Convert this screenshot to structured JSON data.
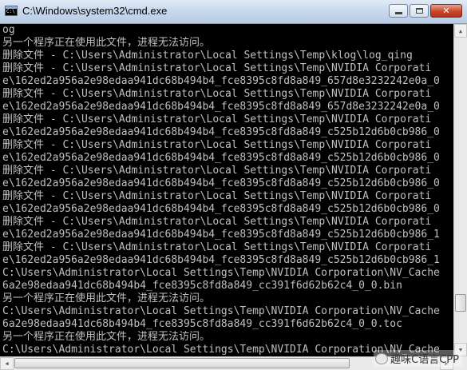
{
  "window": {
    "title": "C:\\Windows\\system32\\cmd.exe",
    "controls": {
      "minimize": "minimize",
      "maximize": "maximize",
      "close": "✕"
    }
  },
  "console": {
    "lines": [
      "og",
      "另一个程序正在使用此文件，进程无法访问。",
      "删除文件 - C:\\Users\\Administrator\\Local Settings\\Temp\\klog\\log_qing",
      "删除文件 - C:\\Users\\Administrator\\Local Settings\\Temp\\NVIDIA Corporati",
      "e\\162ed2a956a2e98edaa941dc68b494b4_fce8395c8fd8a849_657d8e3232242e0a_0",
      "删除文件 - C:\\Users\\Administrator\\Local Settings\\Temp\\NVIDIA Corporati",
      "e\\162ed2a956a2e98edaa941dc68b494b4_fce8395c8fd8a849_657d8e3232242e0a_0",
      "删除文件 - C:\\Users\\Administrator\\Local Settings\\Temp\\NVIDIA Corporati",
      "e\\162ed2a956a2e98edaa941dc68b494b4_fce8395c8fd8a849_c525b12d6b0cb986_0",
      "删除文件 - C:\\Users\\Administrator\\Local Settings\\Temp\\NVIDIA Corporati",
      "e\\162ed2a956a2e98edaa941dc68b494b4_fce8395c8fd8a849_c525b12d6b0cb986_0",
      "删除文件 - C:\\Users\\Administrator\\Local Settings\\Temp\\NVIDIA Corporati",
      "e\\162ed2a956a2e98edaa941dc68b494b4_fce8395c8fd8a849_c525b12d6b0cb986_0",
      "删除文件 - C:\\Users\\Administrator\\Local Settings\\Temp\\NVIDIA Corporati",
      "e\\162ed2a956a2e98edaa941dc68b494b4_fce8395c8fd8a849_c525b12d6b0cb986_0",
      "删除文件 - C:\\Users\\Administrator\\Local Settings\\Temp\\NVIDIA Corporati",
      "e\\162ed2a956a2e98edaa941dc68b494b4_fce8395c8fd8a849_c525b12d6b0cb986_1",
      "删除文件 - C:\\Users\\Administrator\\Local Settings\\Temp\\NVIDIA Corporati",
      "e\\162ed2a956a2e98edaa941dc68b494b4_fce8395c8fd8a849_c525b12d6b0cb986_1",
      "C:\\Users\\Administrator\\Local Settings\\Temp\\NVIDIA Corporation\\NV_Cache",
      "6a2e98edaa941dc68b494b4_fce8395c8fd8a849_cc391f6d62b62c4_0_0.bin",
      "另一个程序正在使用此文件，进程无法访问。",
      "C:\\Users\\Administrator\\Local Settings\\Temp\\NVIDIA Corporation\\NV_Cache",
      "6a2e98edaa941dc68b494b4_fce8395c8fd8a849_cc391f6d62b62c4_0_0.toc",
      "另一个程序正在使用此文件，进程无法访问。",
      "C:\\Users\\Administrator\\Local Settings\\Temp\\NVIDIA Corporation\\NV_Cache"
    ]
  },
  "watermark": {
    "text": "趣味C语言CPP",
    "icon": "wechat-icon"
  },
  "colors": {
    "console_bg": "#000000",
    "console_fg": "#c0c0c0",
    "close": "#c9462c"
  }
}
